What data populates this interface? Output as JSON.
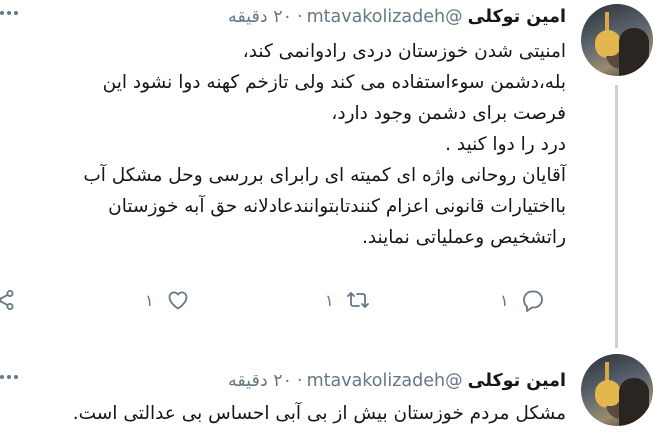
{
  "tweets": [
    {
      "author_name": "امین توکلی",
      "handle": "@mtavakolizadeh",
      "separator": "·",
      "time": "۲۰ دقیقه",
      "lines": [
        "امنیتی شدن خوزستان دردی رادوانمی کند،",
        "بله،دشمن سوءاستفاده می کند ولی تازخم کهنه دوا نشود این",
        "فرصت برای دشمن وجود دارد،",
        "درد را دوا کنید .",
        "آقایان روحانی واژه ای کمیته ای رابرای بررسی وحل مشکل آب",
        "بااختیارات قانونی اعزام کنندتابتوانندعادلانه حق آبه خوزستان",
        "راتشخیص وعملیاتی نمایند."
      ],
      "reply_count": "۱",
      "retweet_count": "۱",
      "like_count": "۱"
    },
    {
      "author_name": "امین توکلی",
      "handle": "@mtavakolizadeh",
      "separator": "·",
      "time": "۲۰ دقیقه",
      "lines": [
        "مشکل مردم خوزستان بیش از بی آبی احساس بی عدالتی است."
      ]
    }
  ],
  "icons": {
    "reply": "reply-icon",
    "retweet": "retweet-icon",
    "like": "heart-icon",
    "share": "share-icon",
    "more": "more-icon"
  },
  "colors": {
    "text": "#14171a",
    "muted": "#657786",
    "thread_line": "#c9d1d8"
  }
}
